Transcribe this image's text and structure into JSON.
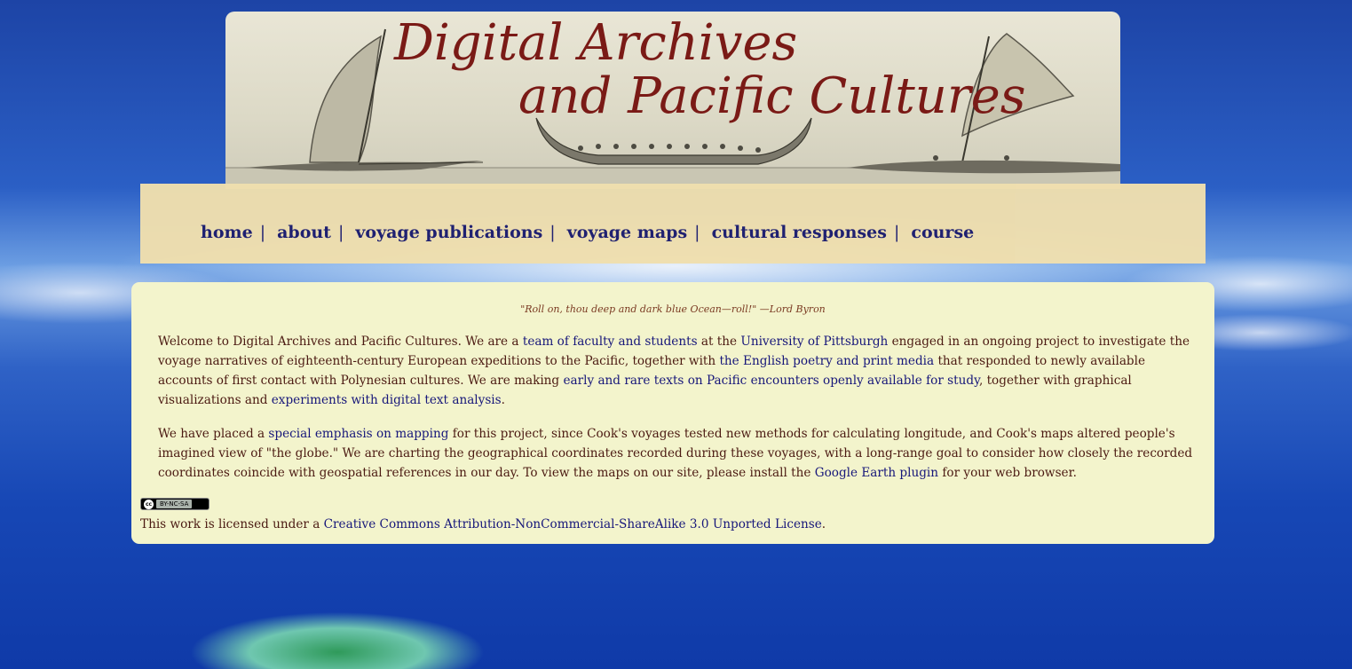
{
  "banner": {
    "title_line1": "Digital Archives",
    "title_line2": "and Pacific Cultures",
    "title_color": "#7a1a16"
  },
  "nav": {
    "items": [
      {
        "label": "home"
      },
      {
        "label": "about"
      },
      {
        "label": "voyage publications"
      },
      {
        "label": "voyage maps"
      },
      {
        "label": "cultural responses"
      },
      {
        "label": "course"
      }
    ],
    "separator": "|",
    "color": "#1d1d6e",
    "background": "#f0dfae"
  },
  "content": {
    "quote": "\"Roll on, thou deep and dark blue Ocean—roll!\" —Lord Byron",
    "p1": {
      "t1": "Welcome to Digital Archives and Pacific Cultures. We are a ",
      "link1": "team of faculty and students",
      "t2": " at the ",
      "link2": "University of Pittsburgh",
      "t3": " engaged in an ongoing project to investigate the voyage narratives of eighteenth-century European expeditions to the Pacific, together with ",
      "link3": "the English poetry and print media",
      "t4": " that responded to newly available accounts of first contact with Polynesian cultures. We are making ",
      "link4": "early and rare texts on Pacific encounters openly available for study",
      "t5": ", together with graphical visualizations and ",
      "link5": "experiments with digital text analysis",
      "t6": "."
    },
    "p2": {
      "t1": "We have placed a ",
      "link1": "special emphasis on mapping",
      "t2": " for this project, since Cook's voyages tested new methods for calculating longitude, and Cook's maps altered people's imagined view of \"the globe.\" We are charting the geographical coordinates recorded during these voyages, with a long-range goal to consider how closely the recorded coordinates coincide with geospatial references in our day. To view the maps on our site, please install the ",
      "link2": "Google Earth plugin",
      "t3": " for your web browser."
    },
    "cc_badge": {
      "symbol": "cc",
      "text": "BY-NC-SA"
    },
    "license": {
      "t1": "This work is licensed under a ",
      "link": "Creative Commons Attribution-NonCommercial-ShareAlike 3.0 Unported License",
      "t2": "."
    },
    "background": "#f3f4cc",
    "text_color": "#4b1a12",
    "link_color": "#17177a"
  }
}
